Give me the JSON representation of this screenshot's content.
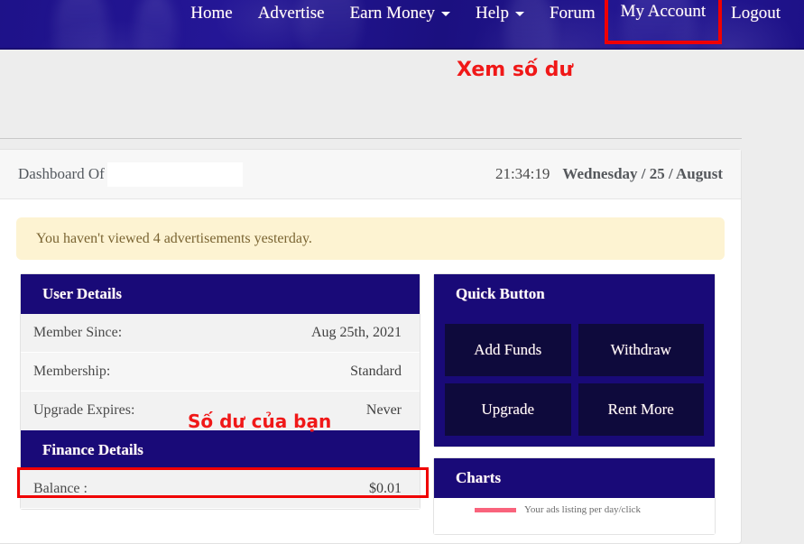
{
  "navbar": {
    "items": [
      {
        "label": "Home",
        "has_caret": false,
        "highlighted": false
      },
      {
        "label": "Advertise",
        "has_caret": false,
        "highlighted": false
      },
      {
        "label": "Earn Money",
        "has_caret": true,
        "highlighted": false
      },
      {
        "label": "Help",
        "has_caret": true,
        "highlighted": false
      },
      {
        "label": "Forum",
        "has_caret": false,
        "highlighted": false
      },
      {
        "label": "My Account",
        "has_caret": false,
        "highlighted": true
      },
      {
        "label": "Logout",
        "has_caret": false,
        "highlighted": false
      }
    ]
  },
  "annotations": {
    "nav_note": "Xem số dư",
    "balance_note": "Số dư của bạn",
    "color": "#f01818"
  },
  "dashboard": {
    "title": "Dashboard Of",
    "username_redacted": "",
    "time": "21:34:19",
    "date": "Wednesday / 25 / August"
  },
  "alert": {
    "message": "You haven't viewed 4 advertisements yesterday."
  },
  "user_details": {
    "heading": "User Details",
    "rows": [
      {
        "label": "Member Since:",
        "value": "Aug 25th, 2021"
      },
      {
        "label": "Membership:",
        "value": "Standard"
      },
      {
        "label": "Upgrade Expires:",
        "value": "Never"
      }
    ]
  },
  "finance_details": {
    "heading": "Finance Details",
    "rows": [
      {
        "label": "Balance :",
        "value": "$0.01"
      }
    ]
  },
  "quick_button": {
    "heading": "Quick Button",
    "buttons": [
      {
        "label": "Add Funds"
      },
      {
        "label": "Withdraw"
      },
      {
        "label": "Upgrade"
      },
      {
        "label": "Rent More"
      }
    ]
  },
  "charts": {
    "heading": "Charts",
    "legend": [
      {
        "label": "Your ads listing per day/click",
        "color": "#f9637c"
      }
    ]
  },
  "colors": {
    "navy": "#190a78",
    "nav_bg": "#1d1187",
    "quick_button": "#0e0a3c",
    "alert_bg": "#fdf3d2",
    "page_bg": "#ededed",
    "highlight_red": "#f00000"
  }
}
